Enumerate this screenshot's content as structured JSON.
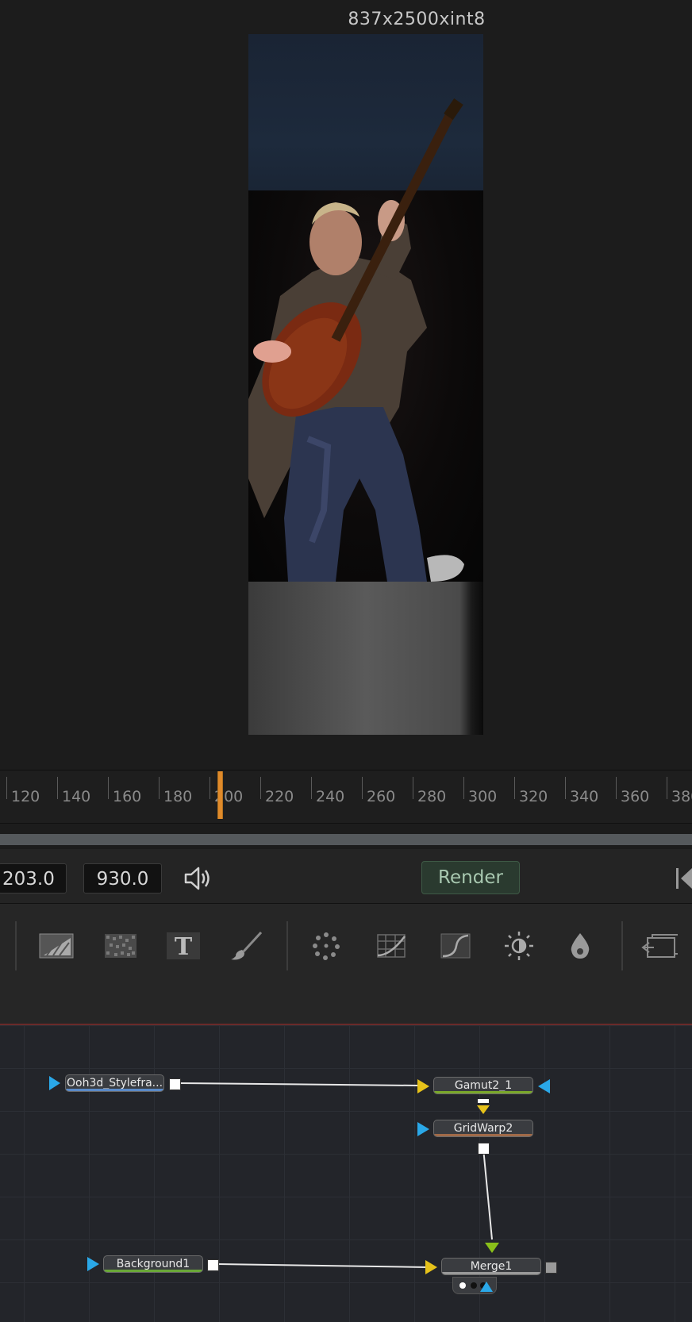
{
  "viewer": {
    "resolution_label": "837x2500xint8"
  },
  "timeline": {
    "ticks": [
      "120",
      "140",
      "160",
      "180",
      "200",
      "220",
      "240",
      "260",
      "280",
      "300",
      "320",
      "340",
      "360",
      "380"
    ],
    "playhead_frame": 200
  },
  "transport": {
    "start_value": "203.0",
    "end_value": "930.0",
    "render_label": "Render"
  },
  "toolbar": {
    "tools": [
      "gradient-icon",
      "noise-icon",
      "text-icon",
      "paint-icon",
      "particles-icon",
      "grid-warp-icon",
      "curves-icon",
      "brightness-contrast-icon",
      "drop-icon",
      "viewer-icon"
    ]
  },
  "nodes": {
    "loader": "Ooh3d_Stylefra...",
    "gamut": "Gamut2_1",
    "gridwarp": "GridWarp2",
    "background": "Background1",
    "merge": "Merge1"
  },
  "colors": {
    "loader_bar": "#5a8ac8",
    "gamut_bar": "#7aa82a",
    "gridwarp_bar": "#a06a48",
    "background_bar": "#6aa838",
    "merge_bar": "#9a9a9a",
    "input_yellow": "#e6c21a",
    "input_blue": "#2aa8e8",
    "input_green": "#8ac01a",
    "playhead": "#e08a2a",
    "render_button": "#2a3a2f"
  }
}
